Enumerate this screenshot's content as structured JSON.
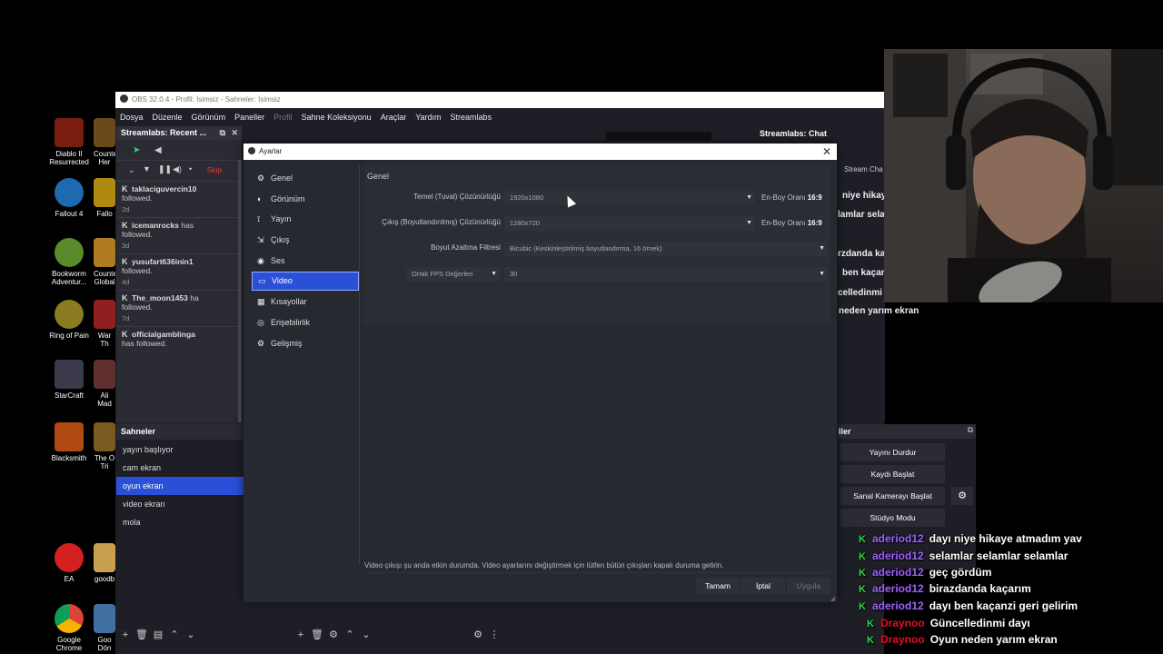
{
  "desktop_icons": [
    {
      "label": "Diablo II Resurrected",
      "color": "#7a1c0e"
    },
    {
      "label": "Fallout 4",
      "color": "#1e6ab0"
    },
    {
      "label": "Bookworm Adventur...",
      "color": "#5a8a2a"
    },
    {
      "label": "Ring of Pain",
      "color": "#8a7a20"
    },
    {
      "label": "StarCraft",
      "color": "#3a3a4a"
    },
    {
      "label": "Blacksmith",
      "color": "#b04a10"
    },
    {
      "label": "EA",
      "color": "#d42020"
    },
    {
      "label": "Google Chrome",
      "color": "#3a86e8"
    }
  ],
  "desktop_icons_partial": [
    {
      "label": "Counte Her",
      "color": "#6a4a1a"
    },
    {
      "label": "Fallo",
      "color": "#b08a10"
    },
    {
      "label": "Counte Global",
      "color": "#b07a20"
    },
    {
      "label": "War Th",
      "color": "#902020"
    },
    {
      "label": "Ali Mad",
      "color": "#603030"
    },
    {
      "label": "The O Tri",
      "color": "#7a5a20"
    },
    {
      "label": "goodb",
      "color": "#c8a050"
    },
    {
      "label": "Goo Dön",
      "color": "#4070a0"
    }
  ],
  "obs": {
    "title": "OBS 32.0.4 - Profil: İsimsiz - Sahneler: İsimsiz",
    "menu": [
      "Dosya",
      "Düzenle",
      "Görünüm",
      "Paneller",
      "Profil",
      "Sahne Koleksiyonu",
      "Araçlar",
      "Yardım",
      "Streamlabs"
    ]
  },
  "recent_events": {
    "title": "Streamlabs: Recent ...",
    "skip_label": "Skip",
    "events": [
      {
        "user": "taklaciguvercin10",
        "action": "followed.",
        "time": "2d"
      },
      {
        "user": "icemanrocks",
        "suffix": "has",
        "action": "followed.",
        "time": "3d"
      },
      {
        "user": "yusufart636inin1",
        "action": "followed.",
        "time": "4d"
      },
      {
        "user": "The_moon1453",
        "suffix": "ha",
        "action": "followed.",
        "time": "7d"
      },
      {
        "user": "officialgamblinga",
        "action": "has followed.",
        "time": ""
      }
    ]
  },
  "scenes": {
    "title": "Sahneler",
    "items": [
      "yayın başlıyor",
      "cam ekran",
      "oyun ekran",
      "video ekran",
      "mola"
    ],
    "selected": 2
  },
  "chat_dock": {
    "title": "Streamlabs: Chat",
    "sub": "Stream Cha",
    "lines": [
      "niye hikay",
      "lamlar selam",
      "rzdanda ka",
      "ben kaçanı",
      "celledinmi d",
      "neden yarım ekran"
    ]
  },
  "controls": {
    "title": "ller",
    "buttons": [
      "Yayını Durdur",
      "Kaydı Başlat",
      "Sanal Kamerayı Başlat",
      "Stüdyo Modu"
    ]
  },
  "settings": {
    "title": "Ayarlar",
    "nav": [
      {
        "label": "Genel",
        "icon": "gear-icon",
        "glyph": "⚙"
      },
      {
        "label": "Görünüm",
        "icon": "appearance-icon",
        "glyph": "◐"
      },
      {
        "label": "Yayın",
        "icon": "broadcast-icon",
        "glyph": "⟟"
      },
      {
        "label": "Çıkış",
        "icon": "output-icon",
        "glyph": "⇲"
      },
      {
        "label": "Ses",
        "icon": "audio-icon",
        "glyph": "◉"
      },
      {
        "label": "Video",
        "icon": "video-icon",
        "glyph": "▭"
      },
      {
        "label": "Kısayollar",
        "icon": "keyboard-icon",
        "glyph": "▦"
      },
      {
        "label": "Erişebilirlik",
        "icon": "accessibility-icon",
        "glyph": "◎"
      },
      {
        "label": "Gelişmiş",
        "icon": "advanced-icon",
        "glyph": "⚙"
      }
    ],
    "selected_nav": 5,
    "group_title": "Genel",
    "base_resolution": {
      "label": "Temel (Tuval) Çözünürlüğü",
      "value": "1920x1080",
      "aspect_label": "En-Boy Oranı",
      "aspect": "16:9"
    },
    "output_resolution": {
      "label": "Çıkış (Boyutlandırılmış) Çözünürlüğü",
      "value": "1280x720",
      "aspect_label": "En-Boy Oranı",
      "aspect": "16:9"
    },
    "downscale_filter": {
      "label": "Boyut Azaltma Filtresi",
      "value": "Bicubic (Keskinleştirilmiş boyutlandırma, 16 örnek)"
    },
    "fps": {
      "label": "Ortak FPS Değerleri",
      "value": "30"
    },
    "warning": "Video çıkışı şu anda etkin durumda. Video ayarlarını değiştirmek için lütfen bütün çıkışları kapalı duruma getirin.",
    "buttons": {
      "ok": "Tamam",
      "cancel": "İptal",
      "apply": "Uygula"
    }
  },
  "chat_overlay": [
    {
      "name": "aderiod12",
      "message": "dayı niye hikaye atmadım yav",
      "badge": "K",
      "name_color": "#a060ff"
    },
    {
      "name": "aderiod12",
      "message": "selamlar selamlar selamlar",
      "badge": "K",
      "name_color": "#a060ff"
    },
    {
      "name": "aderiod12",
      "message": "geç gördüm",
      "badge": "K",
      "name_color": "#a060ff"
    },
    {
      "name": "aderiod12",
      "message": "birazdanda kaçarım",
      "badge": "K",
      "name_color": "#a060ff"
    },
    {
      "name": "aderiod12",
      "message": "dayı ben kaçanzi geri gelirim",
      "badge": "K",
      "name_color": "#a060ff"
    },
    {
      "name": "Draynoo",
      "message": "Güncelledinmi dayı",
      "badge": "K",
      "name_color": "#e0102a"
    },
    {
      "name": "Draynoo",
      "message": "Oyun neden yarım ekran",
      "badge": "K",
      "name_color": "#e0102a"
    }
  ]
}
